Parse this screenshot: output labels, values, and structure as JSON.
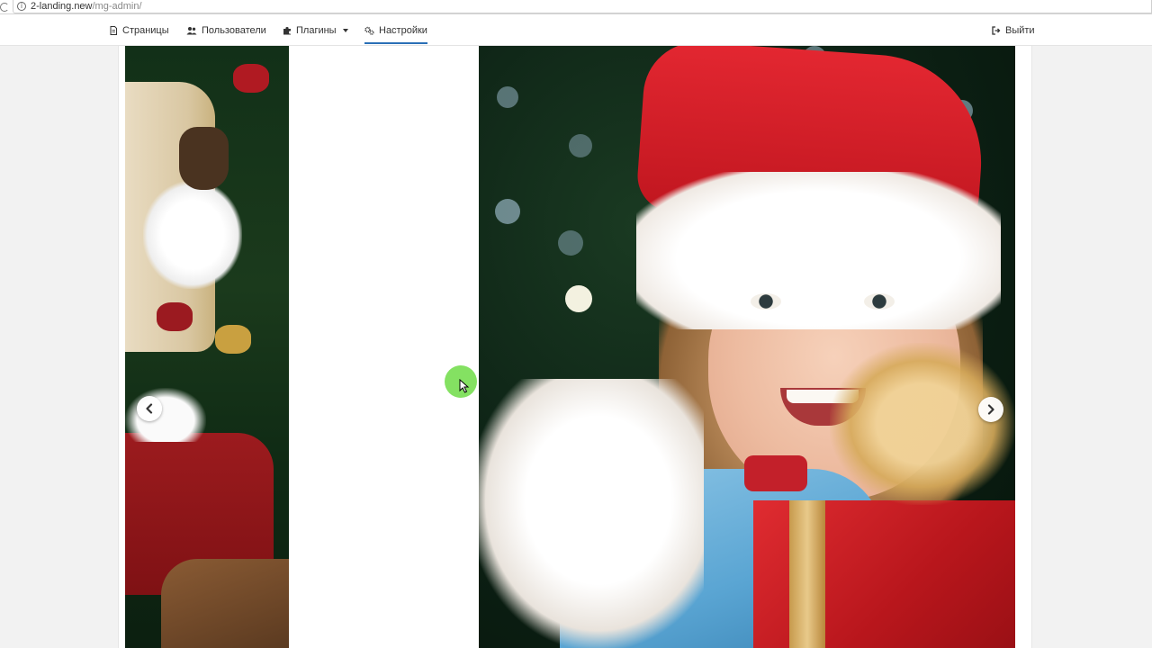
{
  "browser": {
    "url_host": "2-landing.new",
    "url_path": "/mg-admin/"
  },
  "nav": {
    "items": [
      {
        "label": "Страницы",
        "icon": "document-icon"
      },
      {
        "label": "Пользователи",
        "icon": "users-icon"
      },
      {
        "label": "Плагины",
        "icon": "puzzle-icon"
      },
      {
        "label": "Настройки",
        "icon": "gears-icon",
        "active": true
      }
    ],
    "logout": {
      "label": "Выйти",
      "icon": "sign-out-icon"
    }
  },
  "carousel": {
    "prev_icon": "chevron-left-icon",
    "next_icon": "chevron-right-icon",
    "slides": [
      "santa-claus-with-scroll",
      "girl-in-santa-hat-with-present"
    ]
  },
  "colors": {
    "nav_active_underline": "#2a6fb6",
    "page_background": "#f2f2f2",
    "cursor_highlight": "#6edc46"
  }
}
